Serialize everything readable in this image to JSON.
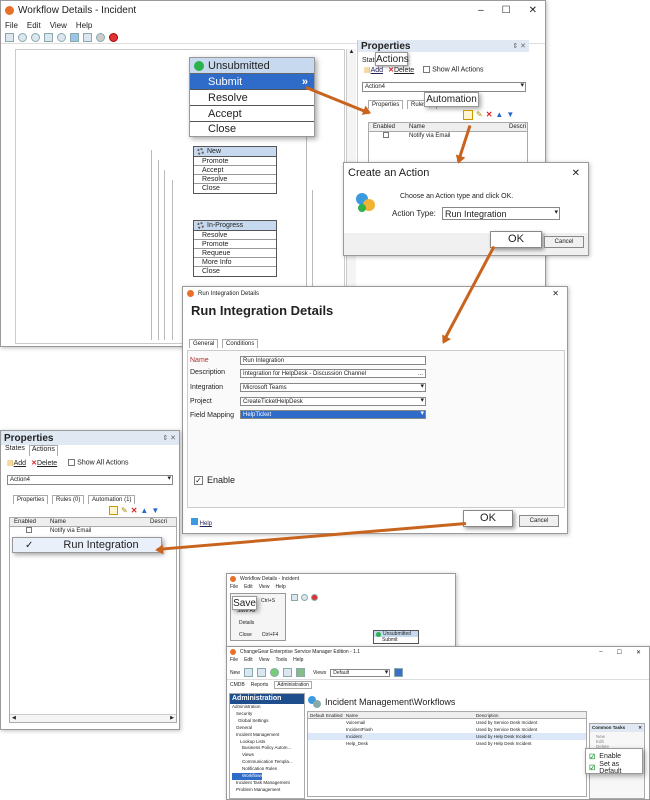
{
  "main_window": {
    "title": "Workflow Details - Incident",
    "menu": [
      "File",
      "Edit",
      "View",
      "Help"
    ],
    "win_controls": [
      "–",
      "☐",
      "✕"
    ]
  },
  "properties_panel": {
    "title": "Properties",
    "tabs": [
      "States",
      "Actions"
    ],
    "add_label": "Add",
    "delete_label": "Delete",
    "show_all_label": "Show All Actions",
    "action_select": "Action4",
    "subtabs": [
      "Properties",
      "Rules (0)",
      "Automation (1)"
    ],
    "columns": [
      "Enabled",
      "Name",
      "Descri"
    ],
    "rows": [
      {
        "name": "Notify via Email"
      },
      {
        "name": "Run Integration"
      }
    ],
    "automation_callout": "Automation",
    "actions_callout": "Actions",
    "panel_ctrls": "⇕ ✕"
  },
  "state_callout": {
    "header": "Unsubmitted",
    "items": [
      "Submit",
      "Resolve",
      "Accept",
      "Close"
    ],
    "selected_glyph": "»"
  },
  "state_new": {
    "header": "New",
    "items": [
      "Promote",
      "Accept",
      "Resolve",
      "Close"
    ]
  },
  "state_inprogress": {
    "header": "In-Progress",
    "items": [
      "Resolve",
      "Promote",
      "Requeue",
      "More Info",
      "Close"
    ]
  },
  "create_action": {
    "title": "Create an Action",
    "prompt": "Choose an Action type and click OK.",
    "type_label": "Action Type:",
    "type_value": "Run Integration",
    "ok": "OK",
    "cancel": "Cancel",
    "close": "✕"
  },
  "run_integration": {
    "title": "Run Integration Details",
    "heading": "Run Integration Details",
    "tabs": [
      "General",
      "Conditions"
    ],
    "labels": {
      "name": "Name",
      "description": "Description",
      "integration": "Integration",
      "project": "Project",
      "field_mapping": "Field Mapping"
    },
    "values": {
      "name": "Run Integration",
      "description": "Integration for HelpDesk - Discussion Channel",
      "integration": "Microsoft Teams",
      "project": "CreateTicketHelpDesk",
      "field_mapping": "HelpTicket"
    },
    "desc_more": "...",
    "enable": "Enable",
    "help": "Help",
    "ok": "OK",
    "cancel": "Cancel",
    "close": "✕"
  },
  "bottom_small": {
    "title": "Workflow Details - Incident",
    "menu": [
      "File",
      "Edit",
      "View",
      "Help"
    ],
    "save_label": "Save",
    "save_shortcut": "Ctrl+S",
    "menu_items": [
      {
        "label": "Save As",
        "shortcut": ""
      },
      {
        "label": "Details",
        "shortcut": ""
      },
      {
        "label": "Close",
        "shortcut": "Ctrl+F4"
      }
    ],
    "state_items": [
      "Unsubmitted",
      "Submit"
    ]
  },
  "esm": {
    "title": "ChangeGear Enterprise Service Manager Edition - 1.1",
    "menu": [
      "File",
      "Edit",
      "View",
      "Tools",
      "Help"
    ],
    "new_label": "New",
    "views_label": "Views",
    "views_value": "Default",
    "tabs": [
      "CMDB",
      "Reports",
      "Administration"
    ],
    "admin_header": "Administration",
    "tree": [
      "Administration",
      "Security",
      "Global Settings",
      "General",
      "Incident Management",
      "Lookup Lists",
      "Business Policy Autom...",
      "Views",
      "Communication Templa...",
      "Notification Rules",
      "Workflows",
      "Incident Task Management",
      "Problem Management"
    ],
    "page_title": "Incident Management\\Workflows",
    "grid_columns": [
      "Default",
      "Enabled",
      "Name",
      "Description"
    ],
    "grid_rows": [
      {
        "name": "Voicemail",
        "desc": "Used by Service Desk Incident"
      },
      {
        "name": "IncidentFlash",
        "desc": "Used by Service Desk Incident"
      },
      {
        "name": "Incident",
        "desc": "Used by Help Desk Incident"
      },
      {
        "name": "Help_Desk",
        "desc": "Used by Help Desk Incident"
      }
    ],
    "common_tasks": "Common Tasks",
    "tasks": [
      "New",
      "Edit",
      "Delete"
    ],
    "task_enable": "Enable",
    "task_default": "Set as Default"
  }
}
